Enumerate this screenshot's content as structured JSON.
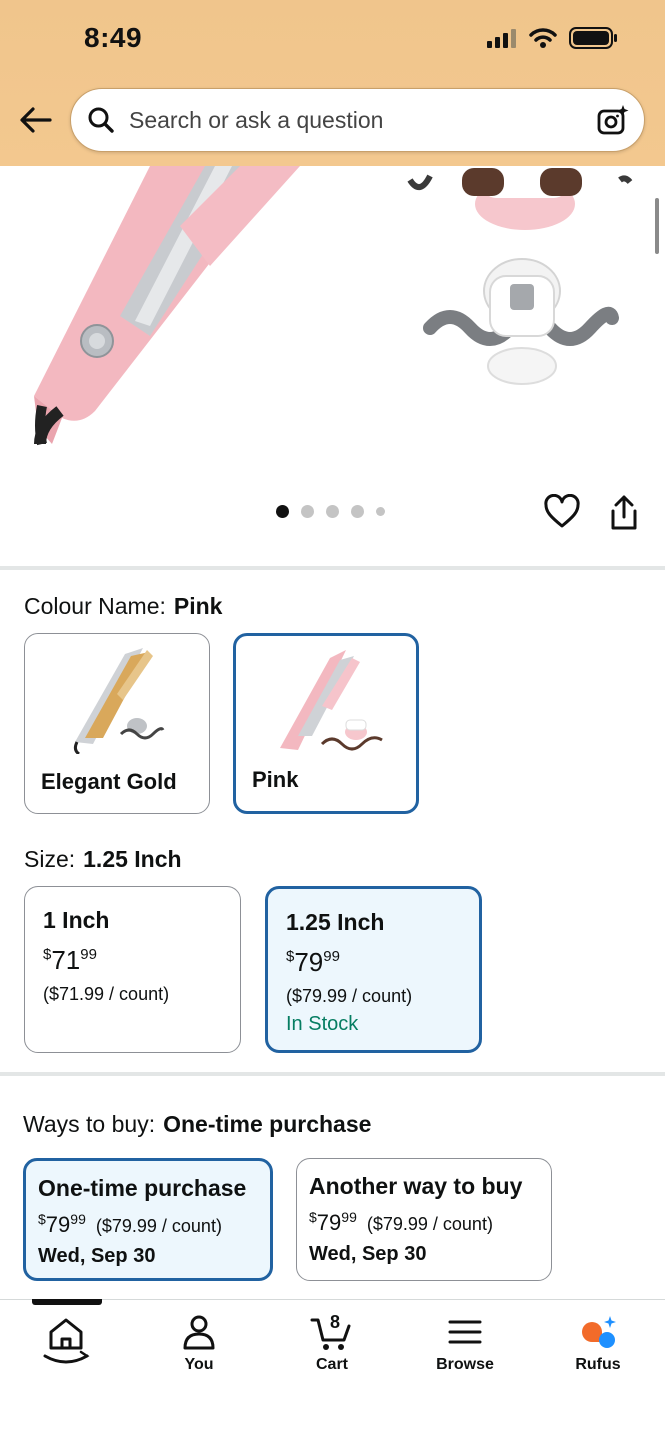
{
  "status_bar": {
    "time": "8:49"
  },
  "search": {
    "placeholder": "Search or ask a question"
  },
  "colour": {
    "label": "Colour Name:",
    "selected": "Pink",
    "options": [
      {
        "name": "Elegant Gold",
        "selected": false
      },
      {
        "name": "Pink",
        "selected": true
      }
    ]
  },
  "size": {
    "label": "Size:",
    "selected": "1.25 Inch",
    "options": [
      {
        "name": "1 Inch",
        "currency": "$",
        "whole": "71",
        "cents": "99",
        "unit_price": "($71.99 / count)",
        "stock": "",
        "selected": false
      },
      {
        "name": "1.25 Inch",
        "currency": "$",
        "whole": "79",
        "cents": "99",
        "unit_price": "($79.99 / count)",
        "stock": "In Stock",
        "selected": true
      }
    ]
  },
  "ways_to_buy": {
    "label": "Ways to buy:",
    "selected": "One-time purchase",
    "options": [
      {
        "title": "One-time purchase",
        "currency": "$",
        "whole": "79",
        "cents": "99",
        "unit_price": "($79.99 / count)",
        "date": "Wed, Sep 30",
        "selected": true
      },
      {
        "title": "Another way to buy",
        "currency": "$",
        "whole": "79",
        "cents": "99",
        "unit_price": "($79.99 / count)",
        "date": "Wed, Sep 30",
        "selected": false
      }
    ]
  },
  "bottom_nav": {
    "items": [
      {
        "label": "",
        "icon": "home-icon"
      },
      {
        "label": "You",
        "icon": "person-icon"
      },
      {
        "label": "Cart",
        "icon": "cart-icon",
        "count": "8"
      },
      {
        "label": "Browse",
        "icon": "menu-icon"
      },
      {
        "label": "Rufus",
        "icon": "rufus-icon"
      }
    ]
  },
  "carousel": {
    "image_count": 5,
    "active_index": 0
  },
  "colors": {
    "header_bg": "#f0c58c",
    "selected_border": "#2162a1",
    "selected_bg": "#edf7fd",
    "in_stock": "#067d62",
    "rufus_orange": "#f26b2a",
    "rufus_blue": "#1e90ff"
  }
}
